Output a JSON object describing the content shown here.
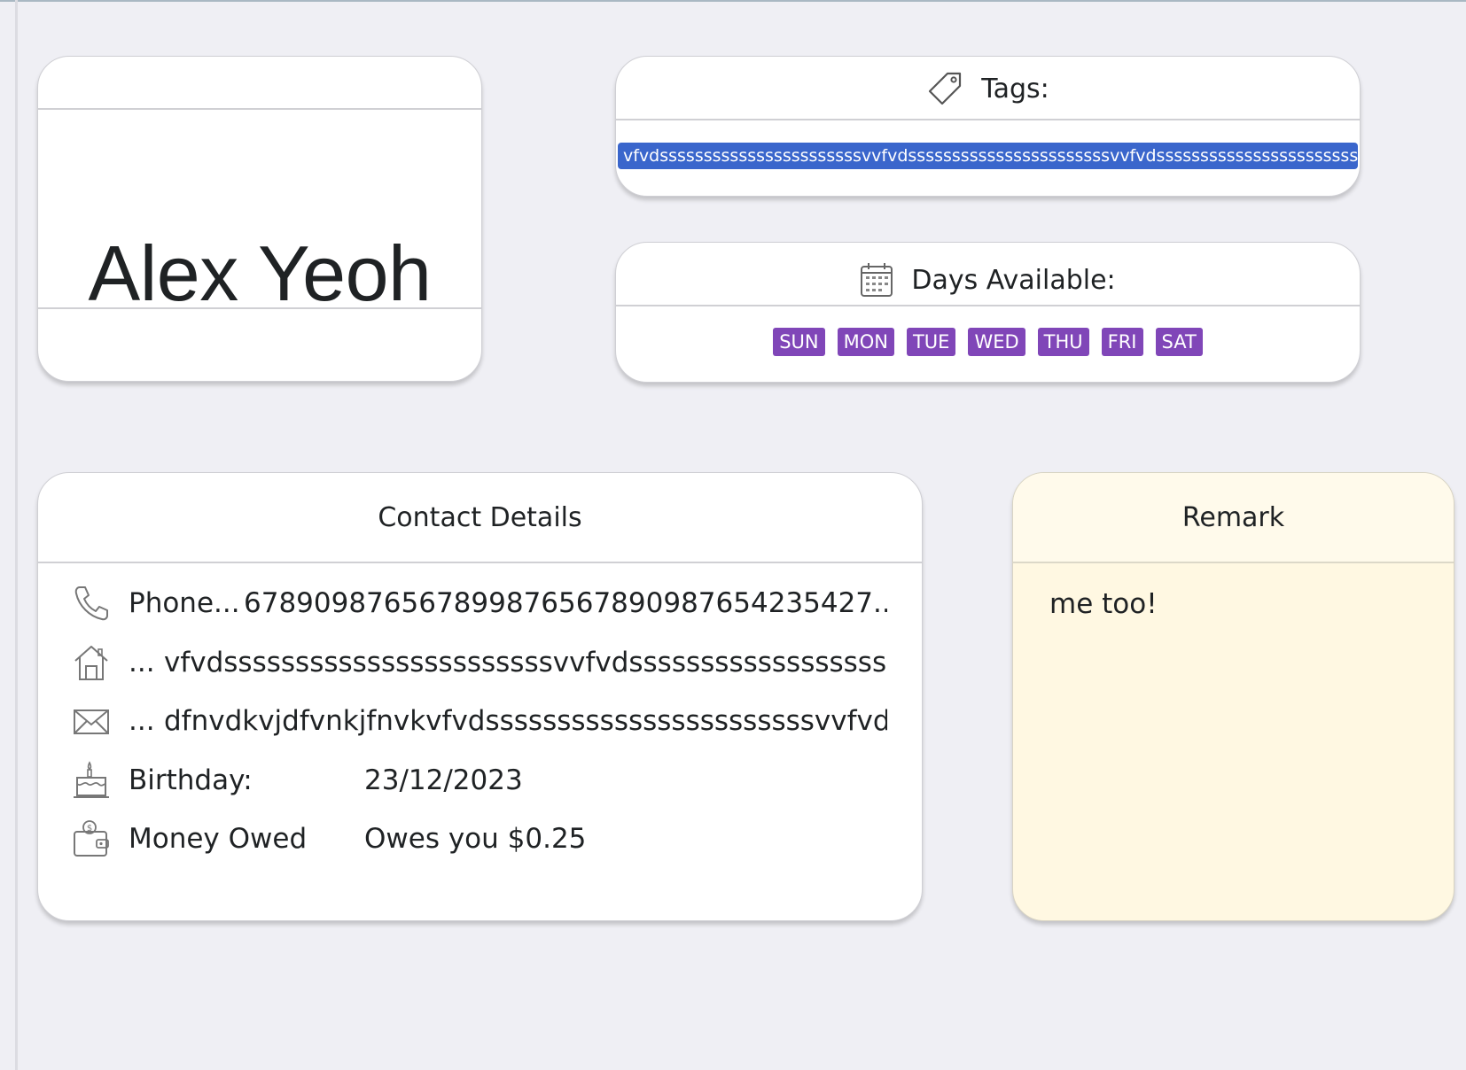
{
  "person": {
    "name": "Alex Yeoh"
  },
  "tags": {
    "header_label": "Tags:",
    "icon": "tag-icon",
    "tag_text": "vfvdsssssssssssssssssssssssvvfvdsssssssssssssssssssssssvvfvdsssssssssssssssssssssssv",
    "tag_color": "#3a66cc"
  },
  "days": {
    "header_label": "Days Available:",
    "icon": "calendar-icon",
    "items": [
      "SUN",
      "MON",
      "TUE",
      "WED",
      "THU",
      "FRI",
      "SAT"
    ],
    "badge_color": "#8046b8"
  },
  "contact": {
    "title": "Contact Details",
    "phone": {
      "icon": "phone-icon",
      "label": "Phone...",
      "value": "67890987656789987656789098765423542​7..."
    },
    "address": {
      "icon": "house-icon",
      "label": "...",
      "value": "vfvdsssssssssssssssssssssssvvfvdssssssssssssssssssssssss..."
    },
    "email": {
      "icon": "envelope-icon",
      "label": "...",
      "value": "dfnvdkvjdfvnkjfnvkvfvdsssssssssssssssssssssssvvfvdsssss..."
    },
    "birthday": {
      "icon": "cake-icon",
      "label": "Birthday:",
      "value": "23/12/2023"
    },
    "money": {
      "icon": "wallet-icon",
      "label": "Money Owed",
      "value": "Owes you $0.25"
    }
  },
  "remark": {
    "title": "Remark",
    "text": "me too!",
    "background": "#fff8e2"
  }
}
